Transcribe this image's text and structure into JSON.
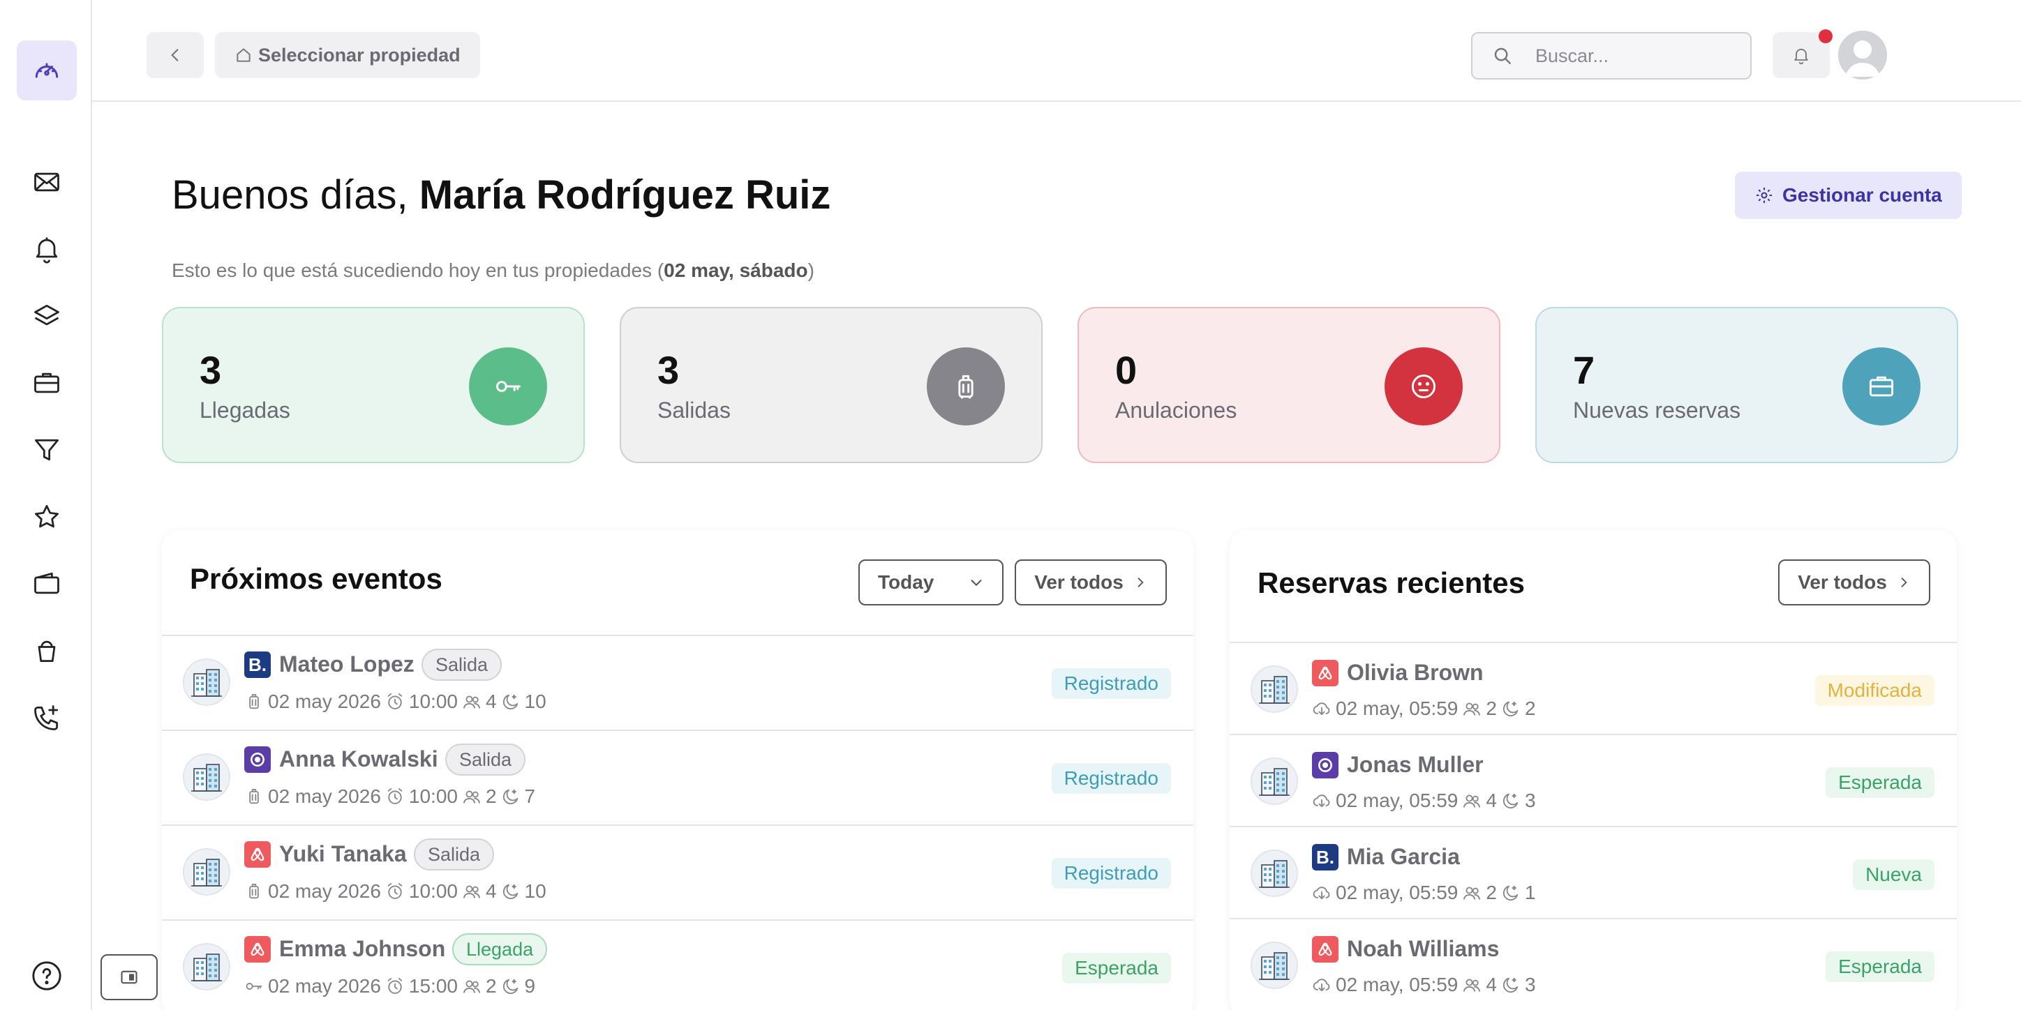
{
  "topbar": {
    "property_label": "Seleccionar propiedad",
    "search_placeholder": "Buscar..."
  },
  "greeting": {
    "prefix": "Buenos días,",
    "name": "María Rodríguez Ruiz",
    "subtitle_prefix": "Esto es lo que está sucediendo hoy en tus propiedades (",
    "subtitle_date": "02 may, sábado",
    "subtitle_suffix": ")",
    "manage_label": "Gestionar cuenta"
  },
  "stats": [
    {
      "value": "3",
      "label": "Llegadas",
      "icon": "key-icon",
      "color": "#5bbd8a"
    },
    {
      "value": "3",
      "label": "Salidas",
      "icon": "luggage-icon",
      "color": "#85858b"
    },
    {
      "value": "0",
      "label": "Anulaciones",
      "icon": "neutral-face-icon",
      "color": "#d2333f"
    },
    {
      "value": "7",
      "label": "Nuevas reservas",
      "icon": "briefcase-icon",
      "color": "#4ea3ba"
    }
  ],
  "events": {
    "title": "Próximos eventos",
    "filter_value": "Today",
    "view_all": "Ver todos",
    "rows": [
      {
        "channel": "booking",
        "name": "Mateo Lopez",
        "tag": "Salida",
        "date": "02 may 2026",
        "time": "10:00",
        "guests": "4",
        "nights": "10",
        "status": "Registrado"
      },
      {
        "channel": "vrbo",
        "name": "Anna Kowalski",
        "tag": "Salida",
        "date": "02 may 2026",
        "time": "10:00",
        "guests": "2",
        "nights": "7",
        "status": "Registrado"
      },
      {
        "channel": "airbnb",
        "name": "Yuki Tanaka",
        "tag": "Salida",
        "date": "02 may 2026",
        "time": "10:00",
        "guests": "4",
        "nights": "10",
        "status": "Registrado"
      },
      {
        "channel": "airbnb",
        "name": "Emma Johnson",
        "tag": "Llegada",
        "date": "02 may 2026",
        "time": "15:00",
        "guests": "2",
        "nights": "9",
        "status": "Esperada"
      }
    ]
  },
  "bookings": {
    "title": "Reservas recientes",
    "view_all": "Ver todos",
    "rows": [
      {
        "channel": "airbnb",
        "name": "Olivia Brown",
        "date": "02 may, 05:59",
        "guests": "2",
        "nights": "2",
        "status": "Modificada"
      },
      {
        "channel": "vrbo",
        "name": "Jonas Muller",
        "date": "02 may, 05:59",
        "guests": "4",
        "nights": "3",
        "status": "Esperada"
      },
      {
        "channel": "booking",
        "name": "Mia Garcia",
        "date": "02 may, 05:59",
        "guests": "2",
        "nights": "1",
        "status": "Nueva"
      },
      {
        "channel": "airbnb",
        "name": "Noah Williams",
        "date": "02 may, 05:59",
        "guests": "4",
        "nights": "3",
        "status": "Esperada"
      }
    ]
  },
  "colors": {
    "accent": "#3d33a8",
    "accent_soft": "#e8e6fb"
  }
}
